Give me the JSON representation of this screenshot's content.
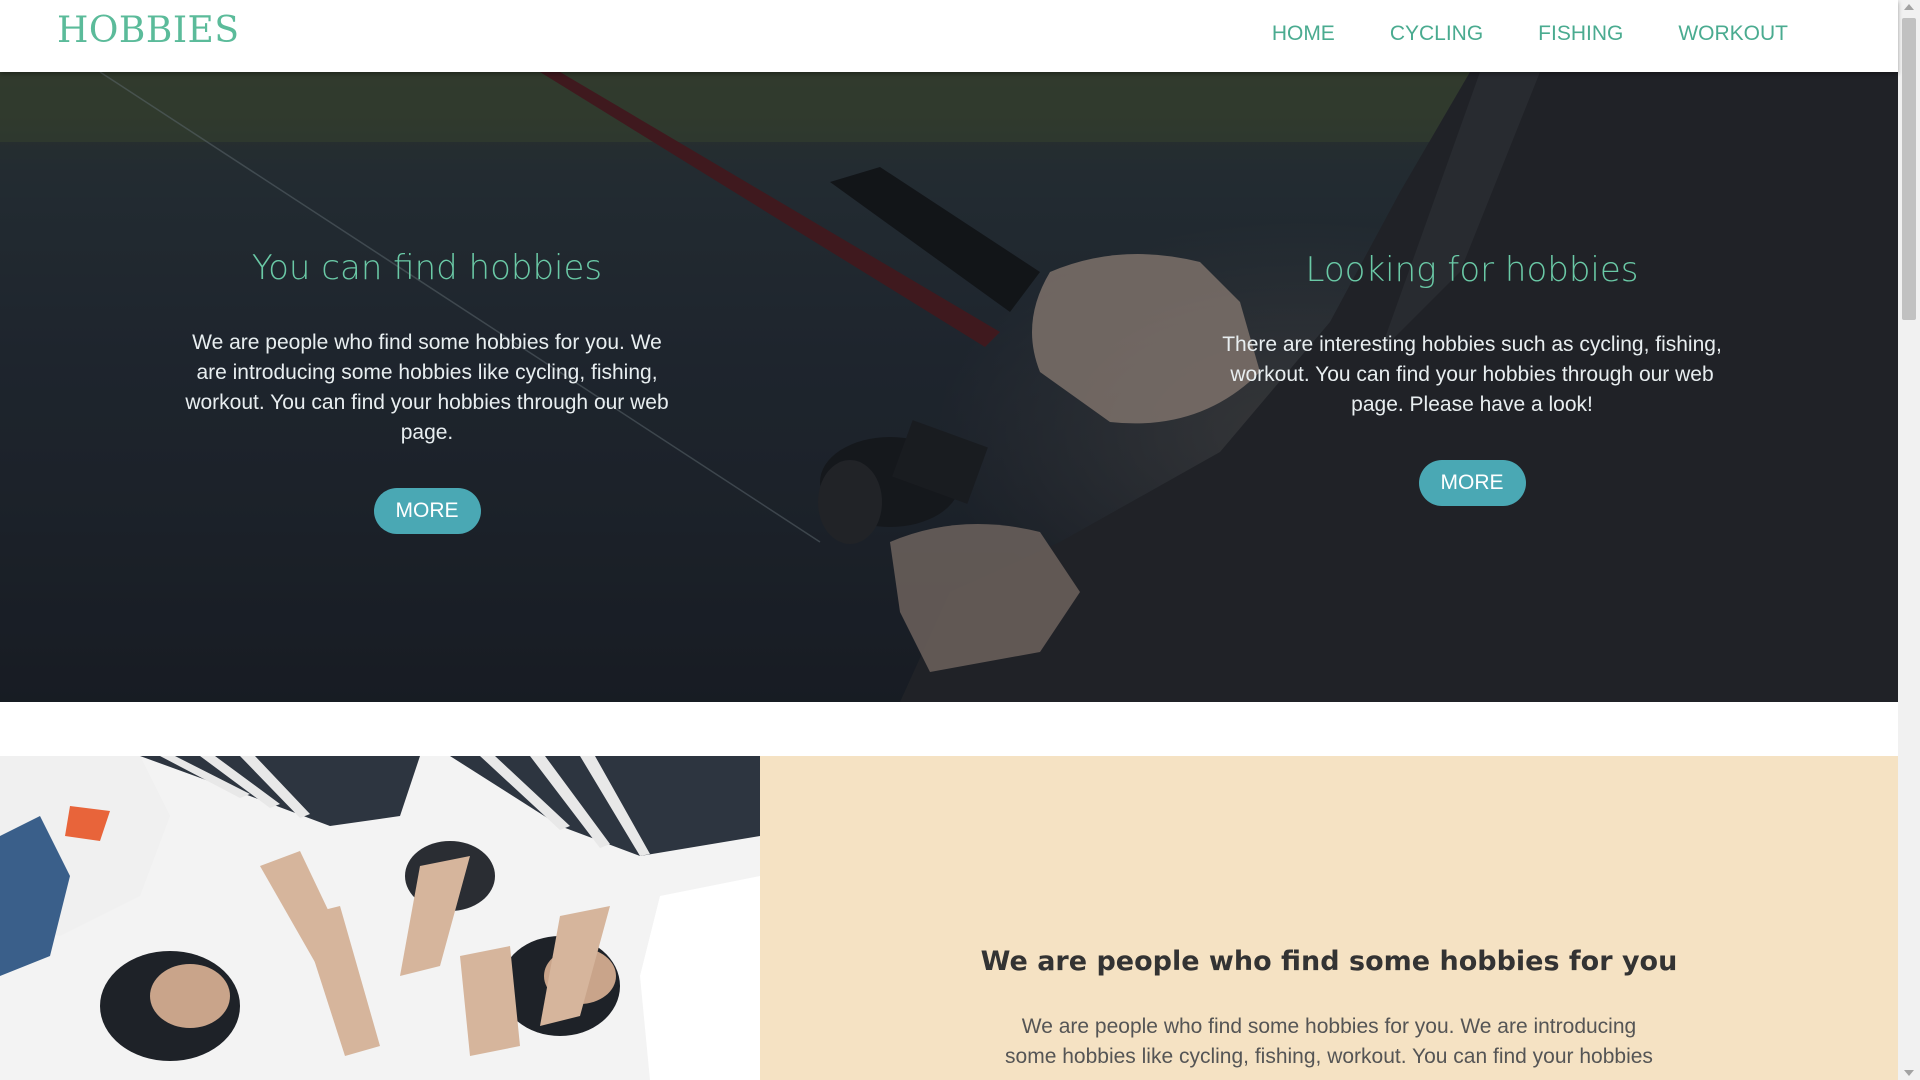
{
  "header": {
    "logo": "HOBBIES",
    "nav": [
      "HOME",
      "CYCLING",
      "FISHING",
      "WORKOUT"
    ]
  },
  "hero": {
    "left": {
      "title": "You can find hobbies",
      "text": "We are people who find some hobbies for you. We are introducing some hobbies like cycling, fishing, workout. You can find your hobbies through our web page.",
      "button": "MORE"
    },
    "right": {
      "title": "Looking for hobbies",
      "text": "There are interesting hobbies such as cycling, fishing, workout. You can find your hobbies through our web page. Please have a look!",
      "button": "MORE"
    }
  },
  "section2": {
    "title": "We are people who find some hobbies for you",
    "text": "We are people who find some hobbies for you. We are introducing some hobbies like cycling, fishing, workout. You can find your hobbies"
  },
  "colors": {
    "accent_green": "#5bbb9a",
    "button_teal": "#4aa8b4",
    "beige": "#f5e2c3"
  }
}
